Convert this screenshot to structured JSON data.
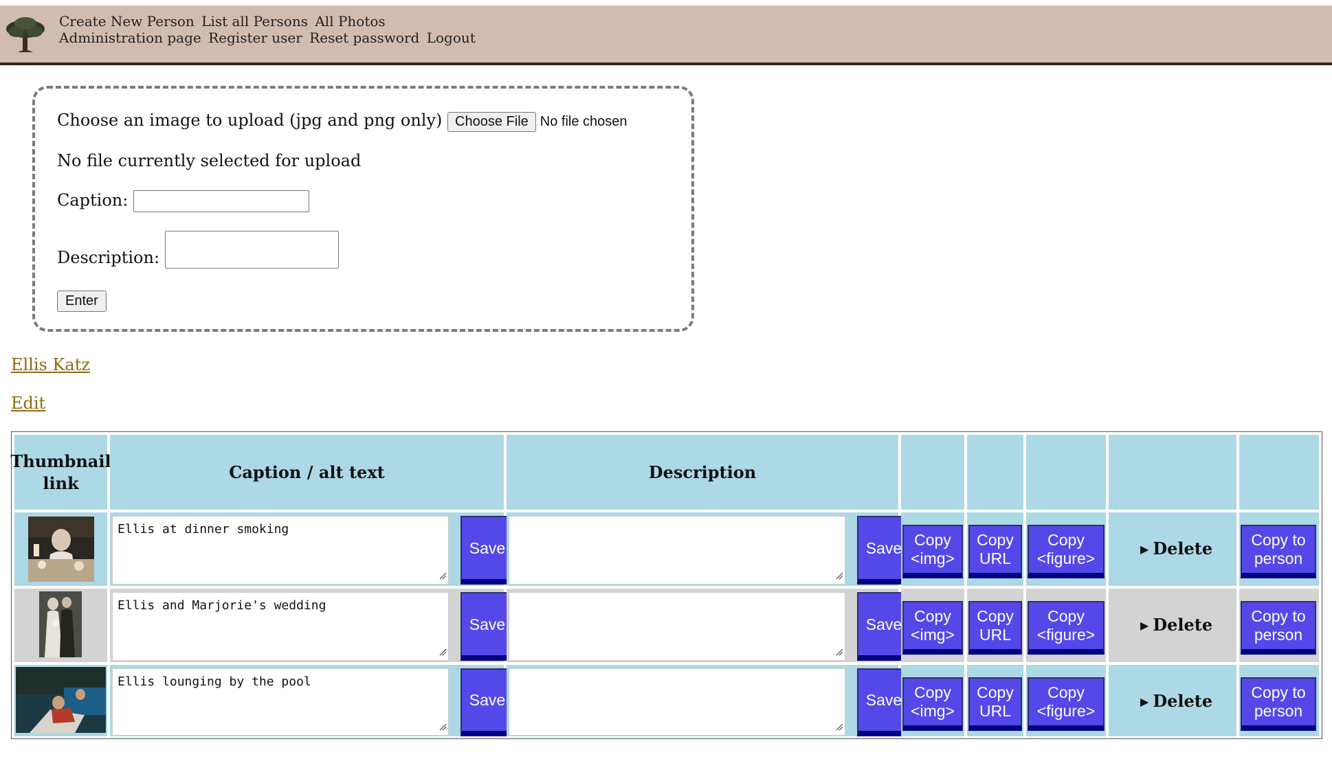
{
  "nav": {
    "row1": [
      "Create New Person",
      "List all Persons",
      "All Photos"
    ],
    "row2": [
      "Administration page",
      "Register user",
      "Reset password",
      "Logout"
    ]
  },
  "upload": {
    "choose_label": "Choose an image to upload (jpg and png only)",
    "choose_button": "Choose File",
    "file_status": "No file chosen",
    "selection_status": "No file currently selected for upload",
    "caption_label": "Caption:",
    "caption_value": "",
    "description_label": "Description:",
    "description_value": "",
    "enter_button": "Enter"
  },
  "person": {
    "name": "Ellis Katz",
    "edit_link": "Edit"
  },
  "table": {
    "headers": {
      "thumbnail": "Thumbnail link",
      "caption": "Caption / alt text",
      "description": "Description"
    },
    "rows": [
      {
        "caption": "Ellis at dinner smoking",
        "description": "",
        "save": "Save",
        "copy_img": "Copy <img>",
        "copy_url": "Copy URL",
        "copy_figure": "Copy <figure>",
        "delete": "Delete",
        "copy_person": "Copy to person"
      },
      {
        "caption": "Ellis and Marjorie's wedding",
        "description": "",
        "save": "Save",
        "copy_img": "Copy <img>",
        "copy_url": "Copy URL",
        "copy_figure": "Copy <figure>",
        "delete": "Delete",
        "copy_person": "Copy to person"
      },
      {
        "caption": "Ellis lounging by the pool",
        "description": "",
        "save": "Save",
        "copy_img": "Copy <img>",
        "copy_url": "Copy URL",
        "copy_figure": "Copy <figure>",
        "delete": "Delete",
        "copy_person": "Copy to person"
      }
    ]
  },
  "colors": {
    "header_bg": "#d1bcb0",
    "table_header_bg": "#add8e6",
    "alt_row_bg": "#d3d3d3",
    "button_bg": "#5548e8",
    "link_color": "#8a6a14"
  }
}
